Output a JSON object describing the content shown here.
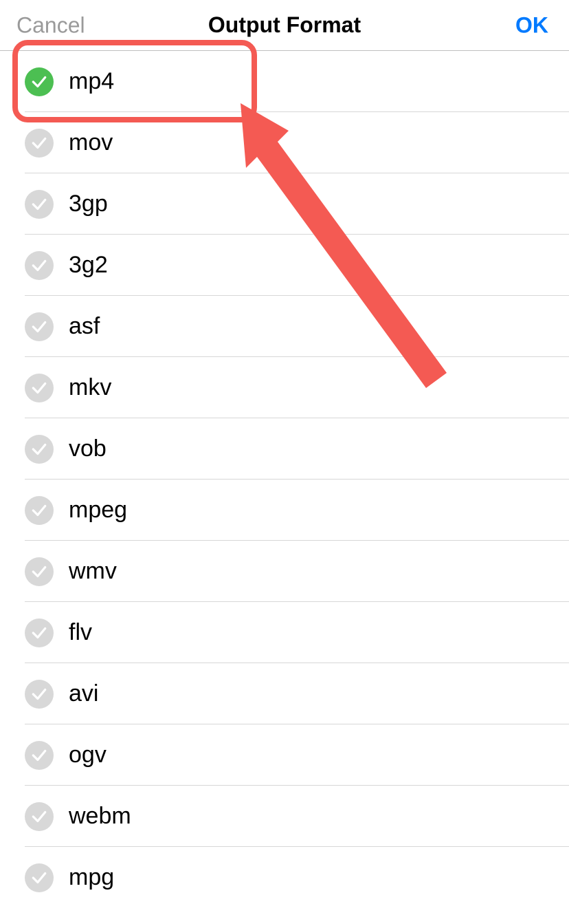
{
  "header": {
    "cancel_label": "Cancel",
    "title": "Output Format",
    "ok_label": "OK"
  },
  "colors": {
    "accent_blue": "#007aff",
    "selected_green": "#4cbf52",
    "annotation_red": "#f45a53",
    "inactive_gray": "#d8d8d8"
  },
  "selected_format": "mp4",
  "formats": [
    {
      "label": "mp4",
      "selected": true
    },
    {
      "label": "mov",
      "selected": false
    },
    {
      "label": "3gp",
      "selected": false
    },
    {
      "label": "3g2",
      "selected": false
    },
    {
      "label": "asf",
      "selected": false
    },
    {
      "label": "mkv",
      "selected": false
    },
    {
      "label": "vob",
      "selected": false
    },
    {
      "label": "mpeg",
      "selected": false
    },
    {
      "label": "wmv",
      "selected": false
    },
    {
      "label": "flv",
      "selected": false
    },
    {
      "label": "avi",
      "selected": false
    },
    {
      "label": "ogv",
      "selected": false
    },
    {
      "label": "webm",
      "selected": false
    },
    {
      "label": "mpg",
      "selected": false
    }
  ],
  "annotation": {
    "highlight_target": "mp4",
    "arrow": true
  }
}
